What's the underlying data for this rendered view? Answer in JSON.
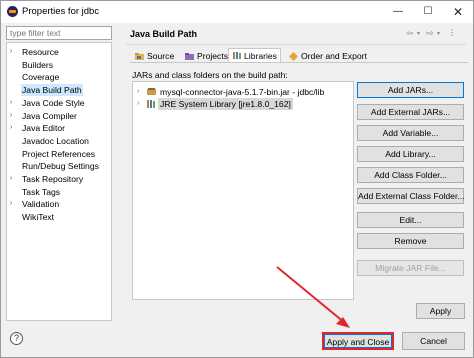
{
  "window": {
    "title": "Properties for jdbc",
    "controls": {
      "minimize": "—",
      "maximize": "☐",
      "close": "✕"
    }
  },
  "filter": {
    "placeholder": "type filter text"
  },
  "nav": {
    "items": [
      {
        "label": "Resource",
        "expandable": true,
        "selected": false
      },
      {
        "label": "Builders",
        "expandable": false,
        "selected": false
      },
      {
        "label": "Coverage",
        "expandable": false,
        "selected": false
      },
      {
        "label": "Java Build Path",
        "expandable": false,
        "selected": true
      },
      {
        "label": "Java Code Style",
        "expandable": true,
        "selected": false
      },
      {
        "label": "Java Compiler",
        "expandable": true,
        "selected": false
      },
      {
        "label": "Java Editor",
        "expandable": true,
        "selected": false
      },
      {
        "label": "Javadoc Location",
        "expandable": false,
        "selected": false
      },
      {
        "label": "Project References",
        "expandable": false,
        "selected": false
      },
      {
        "label": "Run/Debug Settings",
        "expandable": false,
        "selected": false
      },
      {
        "label": "Task Repository",
        "expandable": true,
        "selected": false
      },
      {
        "label": "Task Tags",
        "expandable": false,
        "selected": false
      },
      {
        "label": "Validation",
        "expandable": true,
        "selected": false
      },
      {
        "label": "WikiText",
        "expandable": false,
        "selected": false
      }
    ]
  },
  "page": {
    "title": "Java Build Path",
    "tabs": [
      {
        "label": "Source",
        "icon": "source-folder-icon",
        "active": false
      },
      {
        "label": "Projects",
        "icon": "projects-icon",
        "active": false
      },
      {
        "label": "Libraries",
        "icon": "libraries-icon",
        "active": true
      },
      {
        "label": "Order and Export",
        "icon": "order-export-icon",
        "active": false
      }
    ],
    "libraries_label": "JARs and class folders on the build path:",
    "libraries": [
      {
        "label": "mysql-connector-java-5.1.7-bin.jar - jdbc/lib",
        "icon": "jar-icon",
        "selected": false
      },
      {
        "label": "JRE System Library [jre1.8.0_162]",
        "icon": "library-icon",
        "selected": true
      }
    ],
    "buttons": {
      "add_jars": "Add JARs...",
      "add_external_jars": "Add External JARs...",
      "add_variable": "Add Variable...",
      "add_library": "Add Library...",
      "add_class_folder": "Add Class Folder...",
      "add_external_class_folder": "Add External Class Folder...",
      "edit": "Edit...",
      "remove": "Remove",
      "migrate_jar": "Migrate JAR File..."
    },
    "apply": "Apply"
  },
  "footer": {
    "help": "?",
    "apply_and_close": "Apply and Close",
    "cancel": "Cancel"
  },
  "colors": {
    "selection": "#cde8ff",
    "annotation_red": "#e0262e",
    "focus_blue": "#0078d7"
  }
}
